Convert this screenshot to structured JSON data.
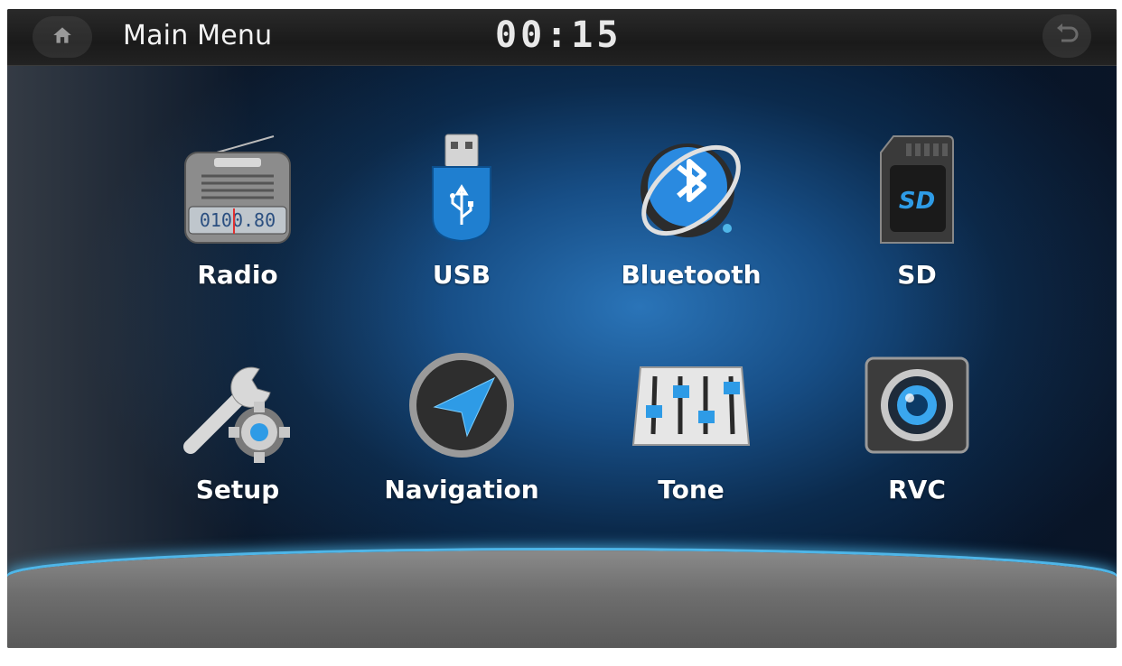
{
  "header": {
    "title": "Main Menu",
    "clock": "00:15",
    "home_icon": "home-icon",
    "back_icon": "back-arrow-icon"
  },
  "menu": {
    "items": [
      {
        "label": "Radio",
        "icon": "radio-icon"
      },
      {
        "label": "USB",
        "icon": "usb-icon"
      },
      {
        "label": "Bluetooth",
        "icon": "bluetooth-icon"
      },
      {
        "label": "SD",
        "icon": "sd-card-icon"
      },
      {
        "label": "Setup",
        "icon": "setup-icon"
      },
      {
        "label": "Navigation",
        "icon": "navigation-icon"
      },
      {
        "label": "Tone",
        "icon": "tone-icon"
      },
      {
        "label": "RVC",
        "icon": "rvc-camera-icon"
      }
    ]
  },
  "radio_dial": "0100.80",
  "colors": {
    "accent": "#4fb6e8",
    "background": "#174e86",
    "topbar": "#1a1a1a"
  }
}
